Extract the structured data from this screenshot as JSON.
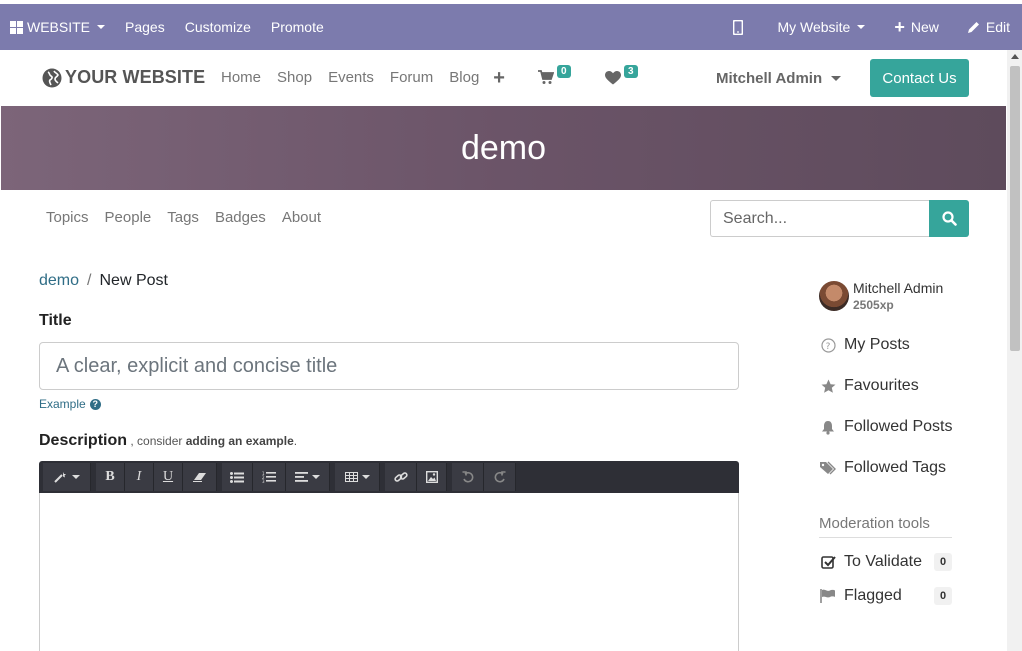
{
  "admin_bar": {
    "website_label": "WEBSITE",
    "pages_label": "Pages",
    "customize_label": "Customize",
    "promote_label": "Promote",
    "site_selector_label": "My Website",
    "new_label": "New",
    "edit_label": "Edit"
  },
  "header": {
    "logo_text": "YOUR WEBSITE",
    "nav": [
      "Home",
      "Shop",
      "Events",
      "Forum",
      "Blog"
    ],
    "cart_count": "0",
    "wishlist_count": "3",
    "user_name": "Mitchell Admin",
    "contact_label": "Contact Us"
  },
  "banner": {
    "title": "demo"
  },
  "forum_nav": {
    "items": [
      "Topics",
      "People",
      "Tags",
      "Badges",
      "About"
    ],
    "search_placeholder": "Search..."
  },
  "form": {
    "breadcrumb_link": "demo",
    "breadcrumb_separator": "/",
    "breadcrumb_current": "New Post",
    "title_label": "Title",
    "title_placeholder": "A clear, explicit and concise title",
    "example_label": "Example",
    "description_label": "Description",
    "description_hint_prefix": " , consider ",
    "description_hint_bold": "adding an example",
    "description_hint_suffix": "."
  },
  "sidebar": {
    "user_name": "Mitchell Admin",
    "user_xp": "2505xp",
    "links": [
      "My Posts",
      "Favourites",
      "Followed Posts",
      "Followed Tags"
    ],
    "moderation_title": "Moderation tools",
    "to_validate_label": "To Validate",
    "to_validate_count": "0",
    "flagged_label": "Flagged",
    "flagged_count": "0"
  },
  "colors": {
    "admin_bar": "#7c7bad",
    "accent": "#36a59b",
    "banner": "#6b5468",
    "link": "#2f6d86"
  }
}
